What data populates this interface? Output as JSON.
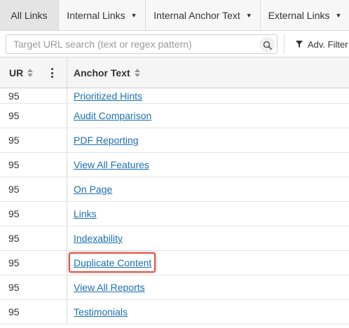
{
  "tabs": [
    {
      "label": "All Links",
      "active": true,
      "has_caret": false
    },
    {
      "label": "Internal Links",
      "active": false,
      "has_caret": true
    },
    {
      "label": "Internal Anchor Text",
      "active": false,
      "has_caret": true
    },
    {
      "label": "External Links",
      "active": false,
      "has_caret": true
    }
  ],
  "search": {
    "placeholder": "Target URL search (text or regex pattern)",
    "value": "",
    "icon": "search-icon"
  },
  "filter": {
    "label": "Adv. Filter",
    "icon": "funnel-icon"
  },
  "table": {
    "columns": [
      {
        "label": "UR",
        "sortable": true,
        "menu_icon": "kebab-menu-icon"
      },
      {
        "label": "Anchor Text",
        "sortable": true
      }
    ],
    "rows": [
      {
        "ur": "95",
        "anchor": "Prioritized Hints",
        "highlighted": false
      },
      {
        "ur": "95",
        "anchor": "Audit Comparison",
        "highlighted": false
      },
      {
        "ur": "95",
        "anchor": "PDF Reporting",
        "highlighted": false
      },
      {
        "ur": "95",
        "anchor": "View All Features",
        "highlighted": false
      },
      {
        "ur": "95",
        "anchor": "On Page",
        "highlighted": false
      },
      {
        "ur": "95",
        "anchor": "Links",
        "highlighted": false
      },
      {
        "ur": "95",
        "anchor": "Indexability",
        "highlighted": false
      },
      {
        "ur": "95",
        "anchor": "Duplicate Content",
        "highlighted": true
      },
      {
        "ur": "95",
        "anchor": "View All Reports",
        "highlighted": false
      },
      {
        "ur": "95",
        "anchor": "Testimonials",
        "highlighted": false
      }
    ]
  },
  "colors": {
    "link": "#1a6fb4",
    "highlight": "#e8543f",
    "tab_active_bg": "#e4e4e4"
  }
}
